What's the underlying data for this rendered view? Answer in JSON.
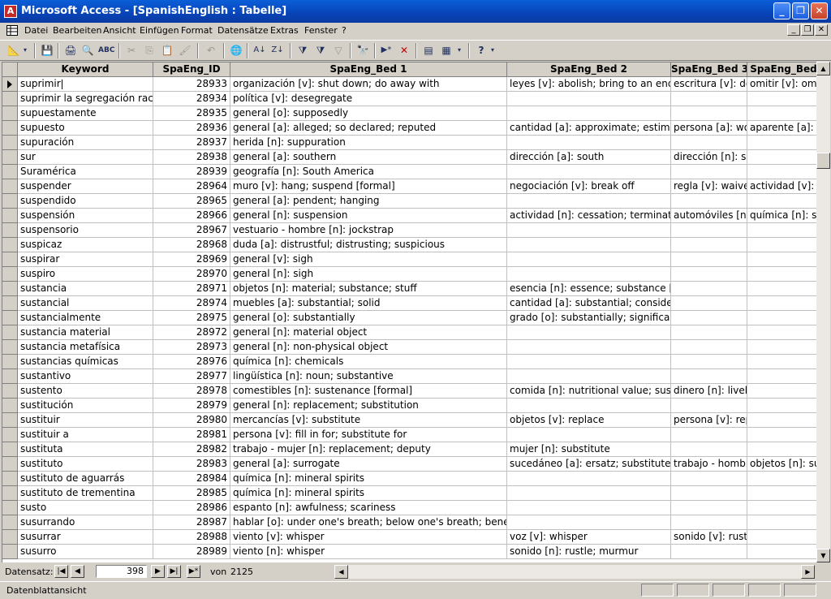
{
  "window": {
    "title": "Microsoft Access - [SpanishEnglish : Tabelle]"
  },
  "menu": [
    "Datei",
    "Bearbeiten",
    "Ansicht",
    "Einfügen",
    "Format",
    "Datensätze",
    "Extras",
    "Fenster",
    "?"
  ],
  "toolbar": [
    "view-icon",
    "save-icon",
    "print-icon",
    "print-preview-icon",
    "spellcheck-icon",
    "cut-icon",
    "copy-icon",
    "paste-icon",
    "format-painter-icon",
    "undo-icon",
    "hyperlink-icon",
    "sort-ascending-icon",
    "sort-descending-icon",
    "filter-by-selection-icon",
    "filter-by-form-icon",
    "apply-filter-icon",
    "find-icon",
    "new-record-icon",
    "delete-record-icon",
    "database-window-icon",
    "new-object-icon",
    "help-icon"
  ],
  "columns": [
    "Keyword",
    "SpaEng_ID",
    "SpaEng_Bed 1",
    "SpaEng_Bed 2",
    "SpaEng_Bed 3",
    "SpaEng_Bed"
  ],
  "rows": [
    [
      "suprimir",
      "28933",
      "organización [v]: shut down; do away with",
      "leyes [v]: abolish; bring to an end",
      "escritura [v]: de",
      "omitir [v]: omit"
    ],
    [
      "suprimir la segregación racial",
      "28934",
      "política [v]: desegregate",
      "",
      "",
      ""
    ],
    [
      "supuestamente",
      "28935",
      "general [o]: supposedly",
      "",
      "",
      ""
    ],
    [
      "supuesto",
      "28936",
      "general [a]: alleged; so declared; reputed",
      "cantidad [a]: approximate; estimate",
      "persona [a]: wo",
      "aparente [a]: a"
    ],
    [
      "supuración",
      "28937",
      "herida [n]: suppuration",
      "",
      "",
      ""
    ],
    [
      "sur",
      "28938",
      "general [a]: southern",
      "dirección [a]: south",
      "dirección [n]: so",
      ""
    ],
    [
      "Suramérica",
      "28939",
      "geografía [n]: South America",
      "",
      "",
      ""
    ],
    [
      "suspender",
      "28964",
      "muro [v]: hang; suspend [formal]",
      "negociación [v]: break off",
      "regla [v]: waive",
      "actividad [v]: s"
    ],
    [
      "suspendido",
      "28965",
      "general [a]: pendent; hanging",
      "",
      "",
      ""
    ],
    [
      "suspensión",
      "28966",
      "general [n]: suspension",
      "actividad [n]: cessation; termination",
      "automóviles [n]:",
      "química [n]: su"
    ],
    [
      "suspensorio",
      "28967",
      "vestuario - hombre [n]: jockstrap",
      "",
      "",
      ""
    ],
    [
      "suspicaz",
      "28968",
      "duda [a]: distrustful; distrusting; suspicious",
      "",
      "",
      ""
    ],
    [
      "suspirar",
      "28969",
      "general [v]: sigh",
      "",
      "",
      ""
    ],
    [
      "suspiro",
      "28970",
      "general [n]: sigh",
      "",
      "",
      ""
    ],
    [
      "sustancia",
      "28971",
      "objetos [n]: material; substance; stuff",
      "esencia [n]: essence; substance [",
      "",
      ""
    ],
    [
      "sustancial",
      "28974",
      "muebles [a]: substantial; solid",
      "cantidad [a]: substantial; consider",
      "",
      ""
    ],
    [
      "sustancialmente",
      "28975",
      "general [o]: substantially",
      "grado [o]: substantially; significant",
      "",
      ""
    ],
    [
      "sustancia material",
      "28972",
      "general [n]: material object",
      "",
      "",
      ""
    ],
    [
      "sustancia metafísica",
      "28973",
      "general [n]: non-physical object",
      "",
      "",
      ""
    ],
    [
      "sustancias químicas",
      "28976",
      "química [n]: chemicals",
      "",
      "",
      ""
    ],
    [
      "sustantivo",
      "28977",
      "lingüística [n]: noun; substantive",
      "",
      "",
      ""
    ],
    [
      "sustento",
      "28978",
      "comestibles [n]: sustenance [formal]",
      "comida [n]: nutritional value; suste",
      "dinero [n]: livelih",
      ""
    ],
    [
      "sustitución",
      "28979",
      "general [n]: replacement; substitution",
      "",
      "",
      ""
    ],
    [
      "sustituir",
      "28980",
      "mercancías [v]: substitute",
      "objetos [v]: replace",
      "persona [v]: rep",
      ""
    ],
    [
      "sustituir a",
      "28981",
      "persona [v]: fill in for; substitute for",
      "",
      "",
      ""
    ],
    [
      "sustituta",
      "28982",
      "trabajo - mujer [n]: replacement; deputy",
      "mujer [n]: substitute",
      "",
      ""
    ],
    [
      "sustituto",
      "28983",
      "general [a]: surrogate",
      "sucedáneo [a]: ersatz; substitute",
      "trabajo - hombre",
      "objetos [n]: su"
    ],
    [
      "sustituto de aguarrás",
      "28984",
      "química [n]: mineral spirits",
      "",
      "",
      ""
    ],
    [
      "sustituto de trementina",
      "28985",
      "química [n]: mineral spirits",
      "",
      "",
      ""
    ],
    [
      "susto",
      "28986",
      "espanto [n]: awfulness; scariness",
      "",
      "",
      ""
    ],
    [
      "susurrando",
      "28987",
      "hablar [o]: under one's breath; below one's breath; beneath",
      "",
      "",
      ""
    ],
    [
      "susurrar",
      "28988",
      "viento [v]: whisper",
      "voz [v]: whisper",
      "sonido [v]: rustl",
      ""
    ],
    [
      "susurro",
      "28989",
      "viento [n]: whisper",
      "sonido [n]: rustle; murmur",
      "",
      ""
    ]
  ],
  "navigation": {
    "label": "Datensatz:",
    "current": "398",
    "of_label": "von",
    "total": "2125"
  },
  "status": {
    "text": "Datenblattansicht"
  }
}
